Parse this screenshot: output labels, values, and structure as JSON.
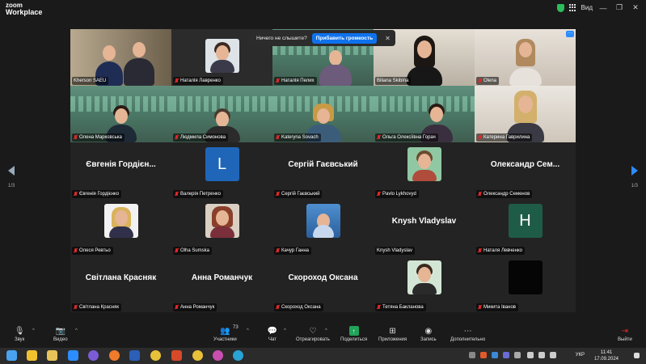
{
  "app": {
    "logo_line1": "zoom",
    "logo_line2": "Workplace"
  },
  "titlebar": {
    "view_label": "Вид"
  },
  "notice": {
    "text": "Ничего не слышите?",
    "button": "Прибавить громкость"
  },
  "pager": {
    "left": "1/3",
    "right": "1/3"
  },
  "row1": [
    {
      "name": "Kherson SAEU"
    },
    {
      "name": "Наталія Лавренко"
    },
    {
      "name": "Наталія Пелих"
    },
    {
      "name": "Biliana Skibina"
    },
    {
      "name": "Olena"
    }
  ],
  "row2": [
    {
      "name": "Олена Марковська"
    },
    {
      "name": "Людмила Симонова"
    },
    {
      "name": "Kateryna Sovach"
    },
    {
      "name": "Ольга Олексіївна Горач"
    },
    {
      "name": "Катерина Гаврилина"
    }
  ],
  "row3": [
    {
      "card": "Євгенія Гордієн...",
      "name": "Євгенія Гордієнко"
    },
    {
      "letter": "L",
      "name": "Валерія Петренко"
    },
    {
      "card": "Сергій Гаєвський",
      "name": "Сергій Гаєвський"
    },
    {
      "name": "Pavlo Lykhovyd"
    },
    {
      "card": "Олександр  Сем...",
      "name": "Олександр Семенов"
    }
  ],
  "row4": [
    {
      "name": "Олеся Ревтьо"
    },
    {
      "name": "Olha Sumska"
    },
    {
      "name": "Качур Ганна"
    },
    {
      "card": "Knysh Vladyslav",
      "name": "Knysh Vladyslav"
    },
    {
      "letter": "H",
      "name": "Наталя Левченко"
    }
  ],
  "row5": [
    {
      "card": "Світлана Красняк",
      "name": "Світлана Красняк"
    },
    {
      "card": "Анна Романчук",
      "name": "Анна Романчук"
    },
    {
      "card": "Скороход Оксана",
      "name": "Скороход Оксана"
    },
    {
      "name": "Тетяна Бакланова"
    },
    {
      "name": "Микита Іванов"
    }
  ],
  "toolbar": {
    "audio": "Звук",
    "video": "Видео",
    "participants": "Участники",
    "participants_count": "73",
    "chat": "Чат",
    "react": "Отреагировать",
    "share": "Поделиться",
    "apps": "Приложения",
    "record": "Запись",
    "more": "Дополнительно",
    "leave": "Выйти"
  },
  "taskbar": {
    "lang": "УКР",
    "time": "11:41",
    "date": "17.09.2024"
  },
  "colors": {
    "accent": "#0e72ed",
    "active_speaker": "#46d36d",
    "muted": "#e02828",
    "avatar_L": "#1f66b8",
    "avatar_H": "#1f5c47"
  }
}
